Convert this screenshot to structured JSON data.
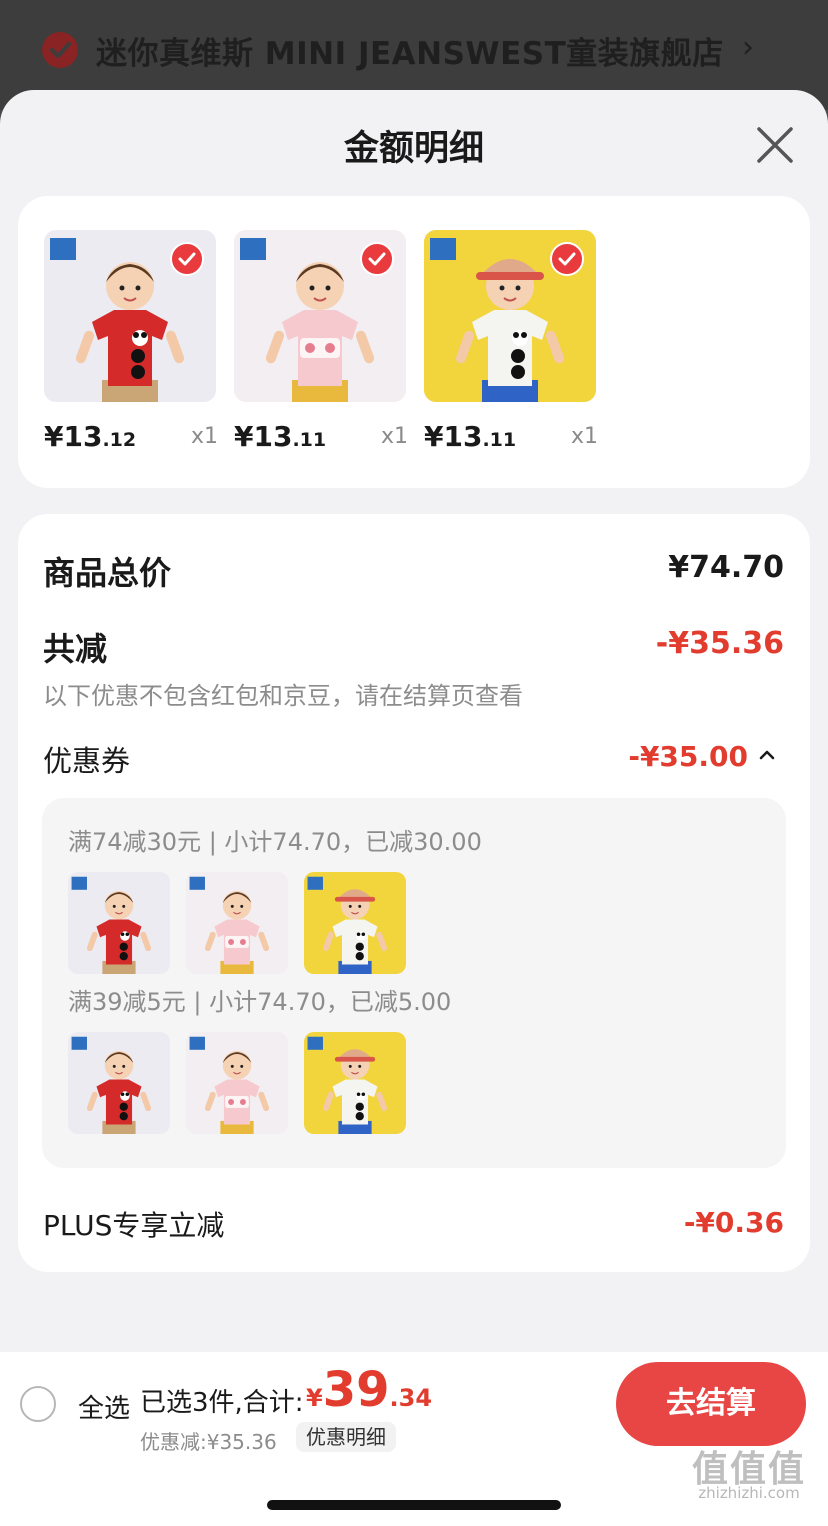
{
  "colors": {
    "accent": "#e23c2f",
    "button": "#e84545",
    "sheet_bg": "#f2f2f4"
  },
  "store": {
    "name": "迷你真维斯 MINI JEANSWEST童装旗舰店",
    "chevron": "›"
  },
  "sheet": {
    "title": "金额明细",
    "close_icon": "close-icon"
  },
  "products": [
    {
      "price_int": "¥13",
      "price_dec": ".12",
      "qty": "x1",
      "shirt": "red",
      "shirt_color": "#d52a2a",
      "bg": "#ecebf1"
    },
    {
      "price_int": "¥13",
      "price_dec": ".11",
      "qty": "x1",
      "shirt": "pink",
      "shirt_color": "#f6c9cf",
      "bg": "#f2eef1"
    },
    {
      "price_int": "¥13",
      "price_dec": ".11",
      "qty": "x1",
      "shirt": "white",
      "shirt_color": "#f4f4f0",
      "bg": "#f2d43d"
    }
  ],
  "detail": {
    "subtotal_label": "商品总价",
    "subtotal_value": "¥74.70",
    "reduce_label": "共减",
    "reduce_value": "-¥35.36",
    "hint": "以下优惠不包含红包和京豆，请在结算页查看",
    "coupon_label": "优惠券",
    "coupon_value": "-¥35.00",
    "coupons": [
      {
        "text": "满74减30元 | 小计74.70，已减30.00"
      },
      {
        "text": "满39减5元 | 小计74.70，已减5.00"
      }
    ],
    "plus_label": "PLUS专享立减",
    "plus_value": "-¥0.36"
  },
  "bottom": {
    "select_all": "全选",
    "selected": "已选3件,合计:",
    "total_currency": "¥",
    "total_int": "39",
    "total_dec": ".34",
    "discount": "优惠减:¥35.36",
    "detail_chip": "优惠明细",
    "checkout": "去结算"
  },
  "watermark": {
    "logo": "值值值",
    "url": "zhizhizhi.com"
  }
}
